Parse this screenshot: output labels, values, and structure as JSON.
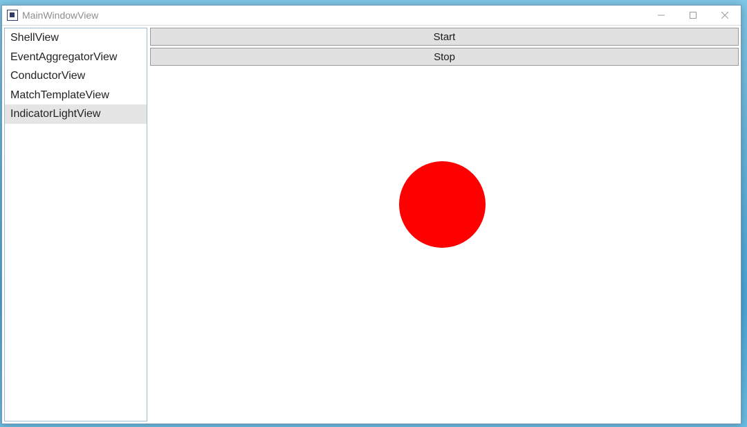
{
  "window": {
    "title": "MainWindowView"
  },
  "sidebar": {
    "items": [
      {
        "label": "ShellView",
        "selected": false
      },
      {
        "label": "EventAggregatorView",
        "selected": false
      },
      {
        "label": "ConductorView",
        "selected": false
      },
      {
        "label": "MatchTemplateView",
        "selected": false
      },
      {
        "label": "IndicatorLightView",
        "selected": true
      }
    ]
  },
  "main": {
    "start_label": "Start",
    "stop_label": "Stop",
    "indicator_color": "#fd0000"
  }
}
